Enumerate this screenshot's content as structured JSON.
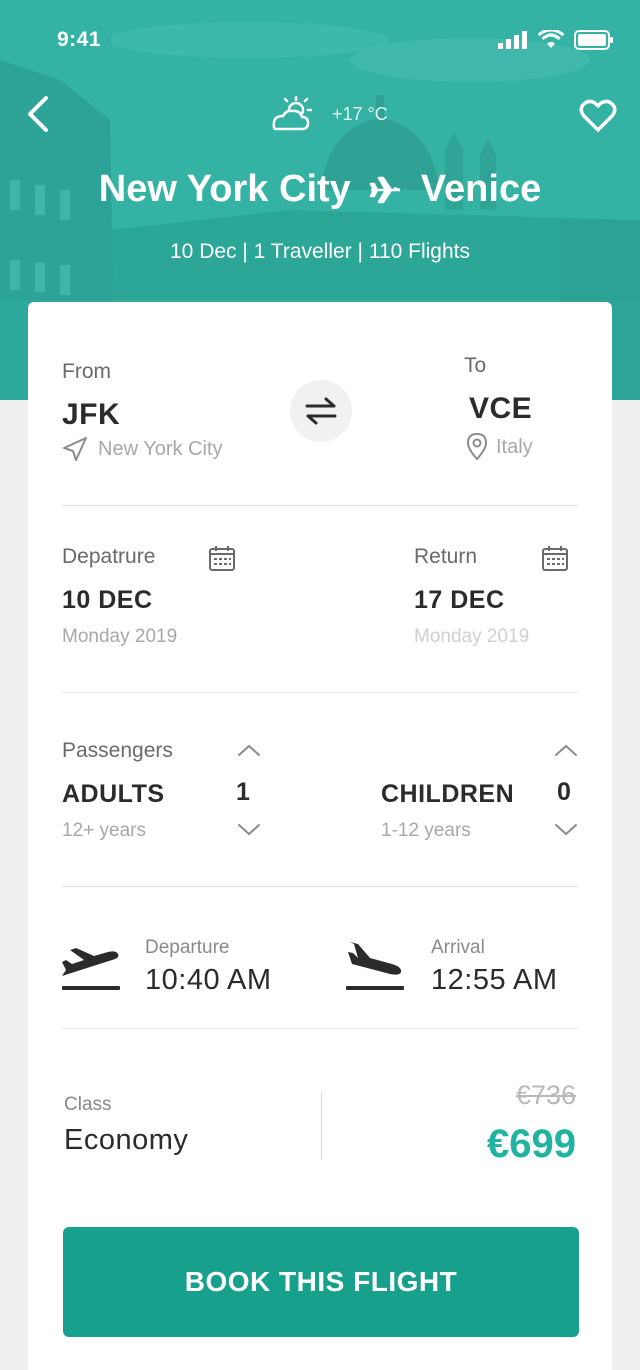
{
  "status_bar": {
    "time": "9:41"
  },
  "header": {
    "temperature": "+17 °C",
    "origin_city": "New York City",
    "destination_city": "Venice",
    "subtitle": "10 Dec | 1 Traveller | 110 Flights"
  },
  "route": {
    "from_label": "From",
    "from_code": "JFK",
    "from_place": "New York City",
    "to_label": "To",
    "to_code": "VCE",
    "to_place": "Italy"
  },
  "dates": {
    "departure_label": "Depatrure",
    "departure_date": "10 DEC",
    "departure_day": "Monday 2019",
    "return_label": "Return",
    "return_date": "17 DEC",
    "return_day": "Monday 2019"
  },
  "passengers": {
    "label": "Passengers",
    "adults_label": "ADULTS",
    "adults_count": "1",
    "adults_range": "12+ years",
    "children_label": "CHILDREN",
    "children_count": "0",
    "children_range": "1-12 years"
  },
  "times": {
    "departure_label": "Departure",
    "departure_time": "10:40 AM",
    "arrival_label": "Arrival",
    "arrival_time": "12:55 AM"
  },
  "fare": {
    "class_label": "Class",
    "class_value": "Economy",
    "old_price": "€736",
    "new_price": "€699"
  },
  "cta": {
    "book_label": "BOOK THIS FLIGHT"
  },
  "colors": {
    "accent": "#20b3a1",
    "button": "#17a08c",
    "header": "#2fb0a2"
  }
}
